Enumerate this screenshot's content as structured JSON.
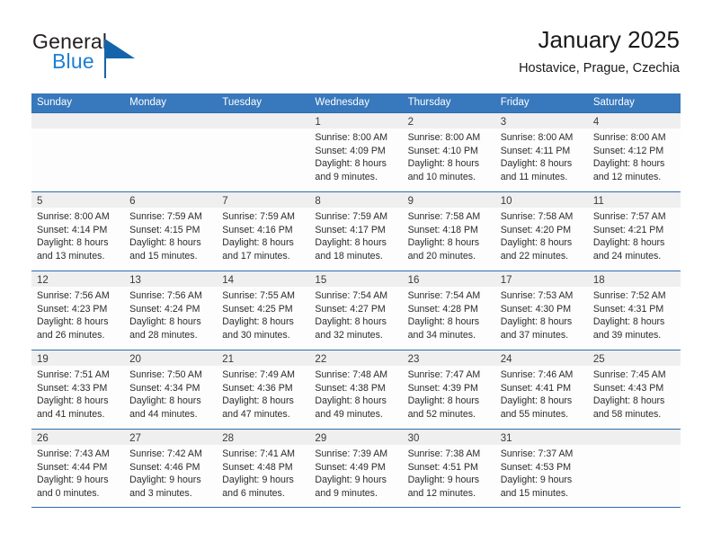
{
  "brand": {
    "name_part1": "General",
    "name_part2": "Blue",
    "accent_color": "#1c7fd4",
    "triangle_color": "#1464ab"
  },
  "header": {
    "title": "January 2025",
    "location": "Hostavice, Prague, Czechia"
  },
  "calendar": {
    "header_color": "#3878bc",
    "weekdays": [
      "Sunday",
      "Monday",
      "Tuesday",
      "Wednesday",
      "Thursday",
      "Friday",
      "Saturday"
    ],
    "weeks": [
      [
        {
          "date": "",
          "lines": []
        },
        {
          "date": "",
          "lines": []
        },
        {
          "date": "",
          "lines": []
        },
        {
          "date": "1",
          "lines": [
            "Sunrise: 8:00 AM",
            "Sunset: 4:09 PM",
            "Daylight: 8 hours",
            "and 9 minutes."
          ]
        },
        {
          "date": "2",
          "lines": [
            "Sunrise: 8:00 AM",
            "Sunset: 4:10 PM",
            "Daylight: 8 hours",
            "and 10 minutes."
          ]
        },
        {
          "date": "3",
          "lines": [
            "Sunrise: 8:00 AM",
            "Sunset: 4:11 PM",
            "Daylight: 8 hours",
            "and 11 minutes."
          ]
        },
        {
          "date": "4",
          "lines": [
            "Sunrise: 8:00 AM",
            "Sunset: 4:12 PM",
            "Daylight: 8 hours",
            "and 12 minutes."
          ]
        }
      ],
      [
        {
          "date": "5",
          "lines": [
            "Sunrise: 8:00 AM",
            "Sunset: 4:14 PM",
            "Daylight: 8 hours",
            "and 13 minutes."
          ]
        },
        {
          "date": "6",
          "lines": [
            "Sunrise: 7:59 AM",
            "Sunset: 4:15 PM",
            "Daylight: 8 hours",
            "and 15 minutes."
          ]
        },
        {
          "date": "7",
          "lines": [
            "Sunrise: 7:59 AM",
            "Sunset: 4:16 PM",
            "Daylight: 8 hours",
            "and 17 minutes."
          ]
        },
        {
          "date": "8",
          "lines": [
            "Sunrise: 7:59 AM",
            "Sunset: 4:17 PM",
            "Daylight: 8 hours",
            "and 18 minutes."
          ]
        },
        {
          "date": "9",
          "lines": [
            "Sunrise: 7:58 AM",
            "Sunset: 4:18 PM",
            "Daylight: 8 hours",
            "and 20 minutes."
          ]
        },
        {
          "date": "10",
          "lines": [
            "Sunrise: 7:58 AM",
            "Sunset: 4:20 PM",
            "Daylight: 8 hours",
            "and 22 minutes."
          ]
        },
        {
          "date": "11",
          "lines": [
            "Sunrise: 7:57 AM",
            "Sunset: 4:21 PM",
            "Daylight: 8 hours",
            "and 24 minutes."
          ]
        }
      ],
      [
        {
          "date": "12",
          "lines": [
            "Sunrise: 7:56 AM",
            "Sunset: 4:23 PM",
            "Daylight: 8 hours",
            "and 26 minutes."
          ]
        },
        {
          "date": "13",
          "lines": [
            "Sunrise: 7:56 AM",
            "Sunset: 4:24 PM",
            "Daylight: 8 hours",
            "and 28 minutes."
          ]
        },
        {
          "date": "14",
          "lines": [
            "Sunrise: 7:55 AM",
            "Sunset: 4:25 PM",
            "Daylight: 8 hours",
            "and 30 minutes."
          ]
        },
        {
          "date": "15",
          "lines": [
            "Sunrise: 7:54 AM",
            "Sunset: 4:27 PM",
            "Daylight: 8 hours",
            "and 32 minutes."
          ]
        },
        {
          "date": "16",
          "lines": [
            "Sunrise: 7:54 AM",
            "Sunset: 4:28 PM",
            "Daylight: 8 hours",
            "and 34 minutes."
          ]
        },
        {
          "date": "17",
          "lines": [
            "Sunrise: 7:53 AM",
            "Sunset: 4:30 PM",
            "Daylight: 8 hours",
            "and 37 minutes."
          ]
        },
        {
          "date": "18",
          "lines": [
            "Sunrise: 7:52 AM",
            "Sunset: 4:31 PM",
            "Daylight: 8 hours",
            "and 39 minutes."
          ]
        }
      ],
      [
        {
          "date": "19",
          "lines": [
            "Sunrise: 7:51 AM",
            "Sunset: 4:33 PM",
            "Daylight: 8 hours",
            "and 41 minutes."
          ]
        },
        {
          "date": "20",
          "lines": [
            "Sunrise: 7:50 AM",
            "Sunset: 4:34 PM",
            "Daylight: 8 hours",
            "and 44 minutes."
          ]
        },
        {
          "date": "21",
          "lines": [
            "Sunrise: 7:49 AM",
            "Sunset: 4:36 PM",
            "Daylight: 8 hours",
            "and 47 minutes."
          ]
        },
        {
          "date": "22",
          "lines": [
            "Sunrise: 7:48 AM",
            "Sunset: 4:38 PM",
            "Daylight: 8 hours",
            "and 49 minutes."
          ]
        },
        {
          "date": "23",
          "lines": [
            "Sunrise: 7:47 AM",
            "Sunset: 4:39 PM",
            "Daylight: 8 hours",
            "and 52 minutes."
          ]
        },
        {
          "date": "24",
          "lines": [
            "Sunrise: 7:46 AM",
            "Sunset: 4:41 PM",
            "Daylight: 8 hours",
            "and 55 minutes."
          ]
        },
        {
          "date": "25",
          "lines": [
            "Sunrise: 7:45 AM",
            "Sunset: 4:43 PM",
            "Daylight: 8 hours",
            "and 58 minutes."
          ]
        }
      ],
      [
        {
          "date": "26",
          "lines": [
            "Sunrise: 7:43 AM",
            "Sunset: 4:44 PM",
            "Daylight: 9 hours",
            "and 0 minutes."
          ]
        },
        {
          "date": "27",
          "lines": [
            "Sunrise: 7:42 AM",
            "Sunset: 4:46 PM",
            "Daylight: 9 hours",
            "and 3 minutes."
          ]
        },
        {
          "date": "28",
          "lines": [
            "Sunrise: 7:41 AM",
            "Sunset: 4:48 PM",
            "Daylight: 9 hours",
            "and 6 minutes."
          ]
        },
        {
          "date": "29",
          "lines": [
            "Sunrise: 7:39 AM",
            "Sunset: 4:49 PM",
            "Daylight: 9 hours",
            "and 9 minutes."
          ]
        },
        {
          "date": "30",
          "lines": [
            "Sunrise: 7:38 AM",
            "Sunset: 4:51 PM",
            "Daylight: 9 hours",
            "and 12 minutes."
          ]
        },
        {
          "date": "31",
          "lines": [
            "Sunrise: 7:37 AM",
            "Sunset: 4:53 PM",
            "Daylight: 9 hours",
            "and 15 minutes."
          ]
        },
        {
          "date": "",
          "lines": []
        }
      ]
    ]
  }
}
